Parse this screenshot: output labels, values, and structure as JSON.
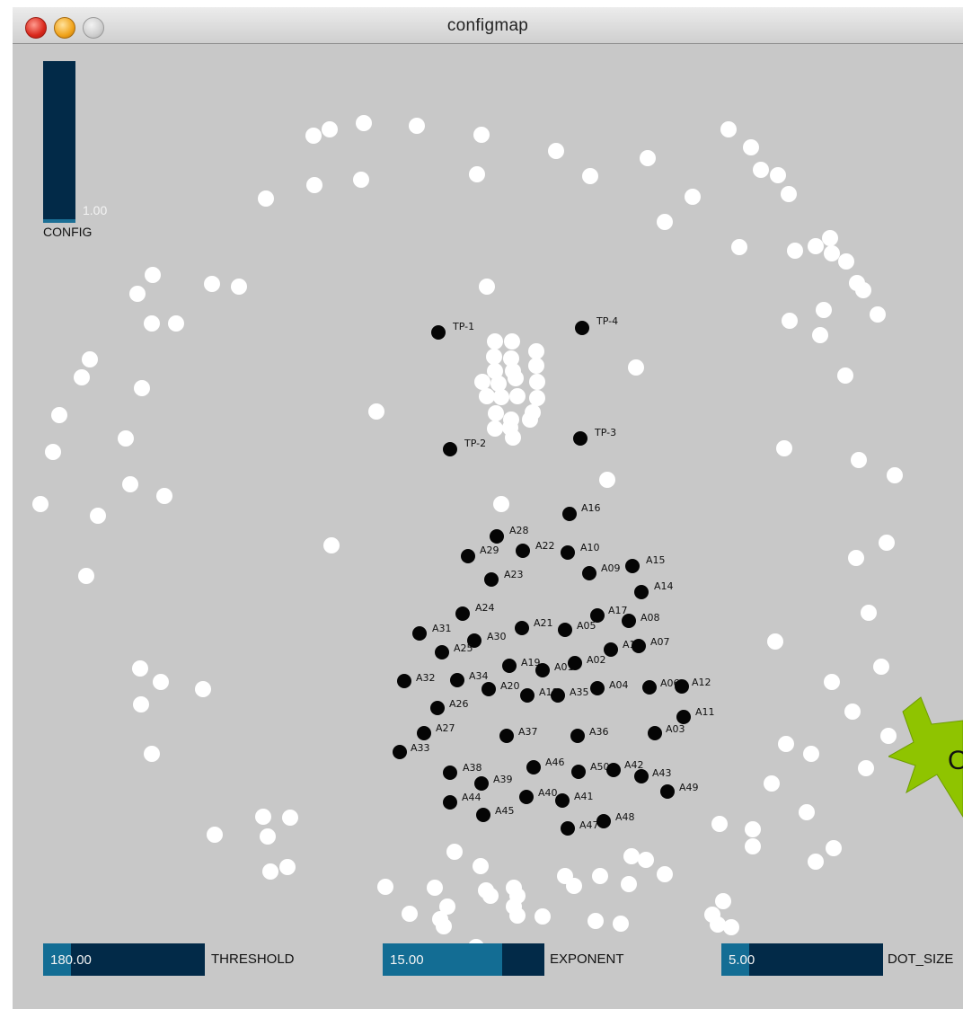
{
  "window": {
    "title": "configmap"
  },
  "config": {
    "value": "1.00",
    "label": "CONFIG",
    "level": 0.02
  },
  "sliders": [
    {
      "value": "180.00",
      "label": "THRESHOLD",
      "level": 0.17
    },
    {
      "value": "15.00",
      "label": "EXPONENT",
      "level": 0.74
    },
    {
      "value": "5.00",
      "label": "DOT_SIZE",
      "level": 0.17
    }
  ],
  "badge": {
    "text": "O"
  },
  "electrodes": [
    "TP-1",
    "TP-4",
    "TP-2",
    "TP-3",
    "A16",
    "A28",
    "A29",
    "A22",
    "A10",
    "A23",
    "A09",
    "A15",
    "A14",
    "A24",
    "A31",
    "A30",
    "A21",
    "A05",
    "A17",
    "A08",
    "A25",
    "A19",
    "A01",
    "A02",
    "A1",
    "A07",
    "A32",
    "A34",
    "A20",
    "A18",
    "A35",
    "A04",
    "A06",
    "A12",
    "A26",
    "A11",
    "A27",
    "A33",
    "A37",
    "A36",
    "A03",
    "A38",
    "A46",
    "A50",
    "A42",
    "A43",
    "A39",
    "A44",
    "A40",
    "A41",
    "A49",
    "A45",
    "A47",
    "A48"
  ]
}
